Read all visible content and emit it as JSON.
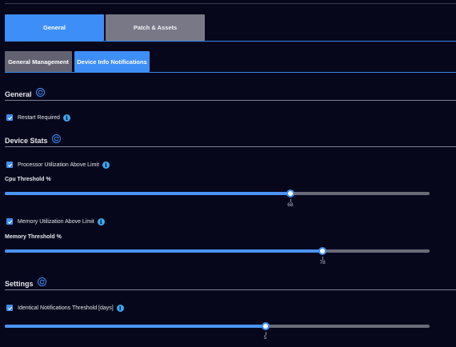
{
  "tabs": {
    "main": [
      {
        "label": "General",
        "active": true
      },
      {
        "label": "Patch & Assets",
        "active": false
      }
    ],
    "sub": [
      {
        "label": "General Management",
        "active": false
      },
      {
        "label": "Device Info Notifications",
        "active": true
      }
    ]
  },
  "sections": {
    "general": {
      "title": "General",
      "restart_required": {
        "label": "Restart Required",
        "checked": true
      }
    },
    "device_stats": {
      "title": "Device Stats",
      "processor": {
        "label": "Processor Utilization Above Limit",
        "checked": true
      },
      "cpu_threshold": {
        "label": "Cpu Threshold %",
        "value": "68",
        "fraction": 0.672
      },
      "memory": {
        "label": "Memory Utilization Above Limit",
        "checked": true
      },
      "memory_threshold": {
        "label": "Memory Threshold %",
        "value": "78",
        "fraction": 0.748
      }
    },
    "settings": {
      "title": "Settings",
      "identical": {
        "label": "Identical Notifications Threshold [days]",
        "checked": true
      },
      "days_threshold": {
        "value": "5",
        "fraction": 0.613
      }
    }
  },
  "colors": {
    "background": "#07071c",
    "accent": "#3e8ef7",
    "tab_inactive": "#787886",
    "info": "#39a9f2"
  },
  "icons": {
    "section_action": "refresh-icon",
    "checkbox": "check-icon",
    "info": "info-icon"
  }
}
